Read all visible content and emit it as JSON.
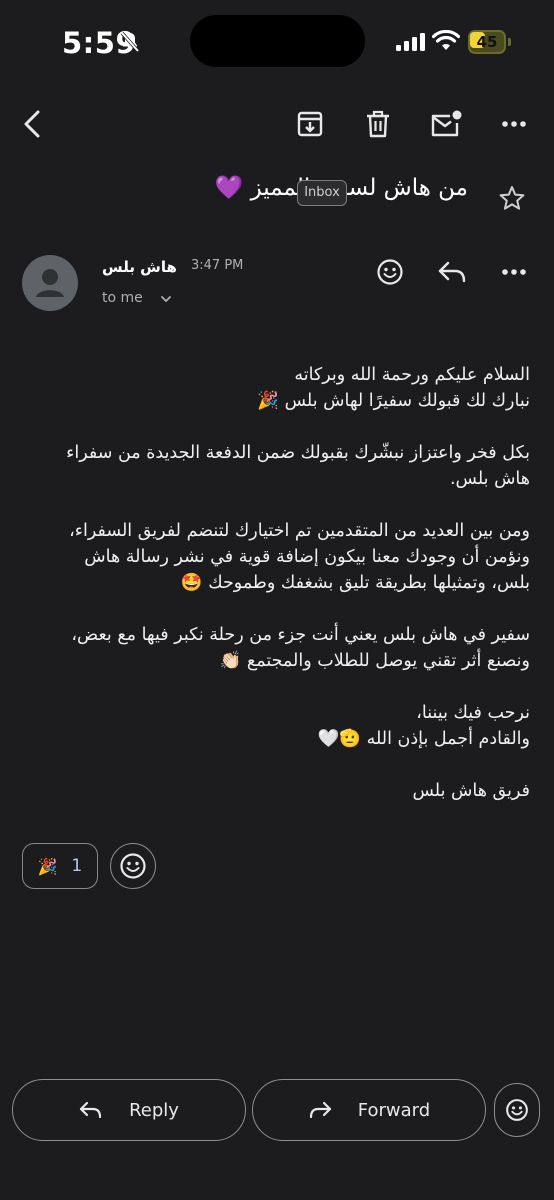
{
  "status_bar": {
    "time": "5:59",
    "battery": "45",
    "battery_level": 0.45,
    "icons": [
      "bell-slash-icon",
      "cellular-signal-icon",
      "wifi-icon",
      "battery-icon"
    ]
  },
  "toolbar": {
    "icons": [
      "back-arrow-icon",
      "archive-icon",
      "trash-icon",
      "mark-unread-icon",
      "more-icon"
    ]
  },
  "email": {
    "subject": "من هاش لسفير المميز 💜",
    "label_chip": "Inbox",
    "sender_name": "هاش بلس",
    "time": "3:47 PM",
    "recipient": "to me",
    "paragraphs": [
      [
        "السلام عليكم ورحمة الله وبركاته",
        "نبارك لك قبولك سفيرًا لهاش بلس 🎉"
      ],
      [
        "بكل فخر واعتزاز نبشّرك بقبولك ضمن الدفعة الجديدة من سفراء",
        "هاش بلس."
      ],
      [
        "ومن بين العديد من المتقدمين تم اختيارك لتنضم لفريق السفراء،",
        "ونؤمن أن وجودك معنا بيكون إضافة قوية في نشر رسالة هاش",
        "بلس، وتمثيلها بطريقة تليق بشغفك وطموحك 🤩"
      ],
      [
        "سفير في هاش بلس يعني أنت جزء من رحلة نكبر فيها مع بعض،",
        "ونصنع أثر تقني يوصل للطلاب والمجتمع 👏🏻"
      ],
      [
        "نرحب فيك بيننا،",
        "والقادم أجمل بإذن الله 🫡🤍"
      ],
      [
        "فريق هاش بلس"
      ]
    ]
  },
  "reactions": {
    "emoji": "🎉",
    "count": "1"
  },
  "actions": {
    "reply_label": "Reply",
    "forward_label": "Forward"
  }
}
